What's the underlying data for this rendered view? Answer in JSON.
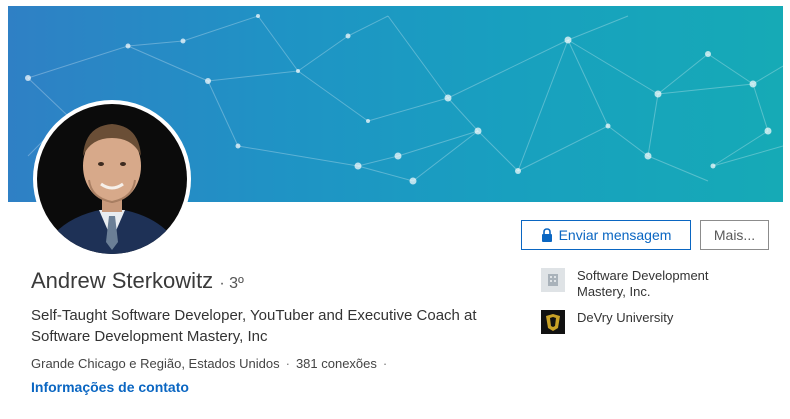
{
  "profile": {
    "name": "Andrew Sterkowitz",
    "degree": "· 3º",
    "headline": "Self-Taught Software Developer, YouTuber and Executive Coach at Software Development Mastery, Inc",
    "location": "Grande Chicago e Região, Estados Unidos",
    "connections": "381 conexões",
    "separator": "·",
    "contact_link": "Informações de contato"
  },
  "actions": {
    "message_label": "Enviar mensagem",
    "message_icon": "lock-icon",
    "more_label": "Mais..."
  },
  "affiliations": [
    {
      "label": "Software Development Mastery, Inc.",
      "icon": "company-logo-icon"
    },
    {
      "label": "DeVry University",
      "icon": "university-logo-icon"
    }
  ],
  "colors": {
    "banner_start": "#2f80c5",
    "banner_end": "#16aab6",
    "accent": "#0a66c2",
    "text": "#333333"
  }
}
